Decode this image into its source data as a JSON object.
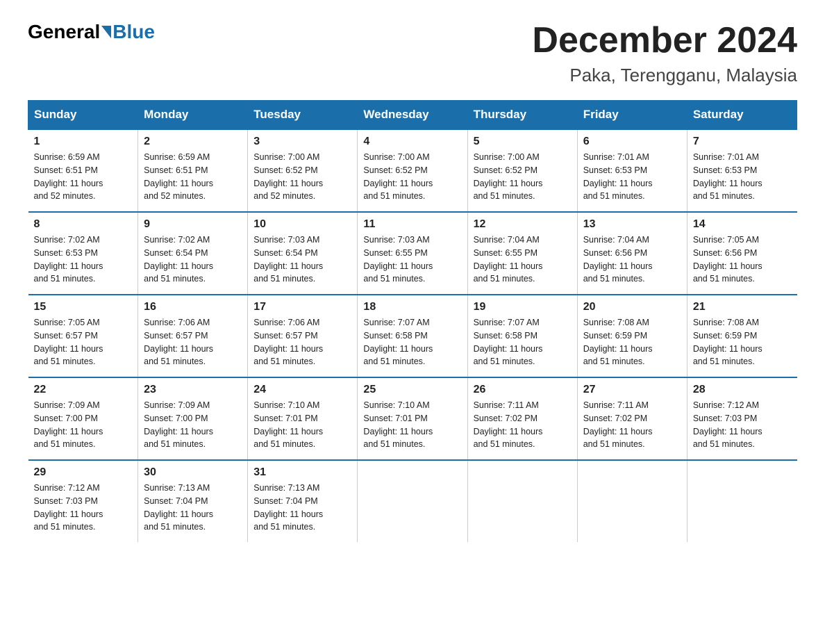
{
  "logo": {
    "general": "General",
    "blue": "Blue"
  },
  "title": "December 2024",
  "location": "Paka, Terengganu, Malaysia",
  "headers": [
    "Sunday",
    "Monday",
    "Tuesday",
    "Wednesday",
    "Thursday",
    "Friday",
    "Saturday"
  ],
  "weeks": [
    [
      {
        "day": "1",
        "sunrise": "6:59 AM",
        "sunset": "6:51 PM",
        "daylight": "11 hours and 52 minutes."
      },
      {
        "day": "2",
        "sunrise": "6:59 AM",
        "sunset": "6:51 PM",
        "daylight": "11 hours and 52 minutes."
      },
      {
        "day": "3",
        "sunrise": "7:00 AM",
        "sunset": "6:52 PM",
        "daylight": "11 hours and 52 minutes."
      },
      {
        "day": "4",
        "sunrise": "7:00 AM",
        "sunset": "6:52 PM",
        "daylight": "11 hours and 51 minutes."
      },
      {
        "day": "5",
        "sunrise": "7:00 AM",
        "sunset": "6:52 PM",
        "daylight": "11 hours and 51 minutes."
      },
      {
        "day": "6",
        "sunrise": "7:01 AM",
        "sunset": "6:53 PM",
        "daylight": "11 hours and 51 minutes."
      },
      {
        "day": "7",
        "sunrise": "7:01 AM",
        "sunset": "6:53 PM",
        "daylight": "11 hours and 51 minutes."
      }
    ],
    [
      {
        "day": "8",
        "sunrise": "7:02 AM",
        "sunset": "6:53 PM",
        "daylight": "11 hours and 51 minutes."
      },
      {
        "day": "9",
        "sunrise": "7:02 AM",
        "sunset": "6:54 PM",
        "daylight": "11 hours and 51 minutes."
      },
      {
        "day": "10",
        "sunrise": "7:03 AM",
        "sunset": "6:54 PM",
        "daylight": "11 hours and 51 minutes."
      },
      {
        "day": "11",
        "sunrise": "7:03 AM",
        "sunset": "6:55 PM",
        "daylight": "11 hours and 51 minutes."
      },
      {
        "day": "12",
        "sunrise": "7:04 AM",
        "sunset": "6:55 PM",
        "daylight": "11 hours and 51 minutes."
      },
      {
        "day": "13",
        "sunrise": "7:04 AM",
        "sunset": "6:56 PM",
        "daylight": "11 hours and 51 minutes."
      },
      {
        "day": "14",
        "sunrise": "7:05 AM",
        "sunset": "6:56 PM",
        "daylight": "11 hours and 51 minutes."
      }
    ],
    [
      {
        "day": "15",
        "sunrise": "7:05 AM",
        "sunset": "6:57 PM",
        "daylight": "11 hours and 51 minutes."
      },
      {
        "day": "16",
        "sunrise": "7:06 AM",
        "sunset": "6:57 PM",
        "daylight": "11 hours and 51 minutes."
      },
      {
        "day": "17",
        "sunrise": "7:06 AM",
        "sunset": "6:57 PM",
        "daylight": "11 hours and 51 minutes."
      },
      {
        "day": "18",
        "sunrise": "7:07 AM",
        "sunset": "6:58 PM",
        "daylight": "11 hours and 51 minutes."
      },
      {
        "day": "19",
        "sunrise": "7:07 AM",
        "sunset": "6:58 PM",
        "daylight": "11 hours and 51 minutes."
      },
      {
        "day": "20",
        "sunrise": "7:08 AM",
        "sunset": "6:59 PM",
        "daylight": "11 hours and 51 minutes."
      },
      {
        "day": "21",
        "sunrise": "7:08 AM",
        "sunset": "6:59 PM",
        "daylight": "11 hours and 51 minutes."
      }
    ],
    [
      {
        "day": "22",
        "sunrise": "7:09 AM",
        "sunset": "7:00 PM",
        "daylight": "11 hours and 51 minutes."
      },
      {
        "day": "23",
        "sunrise": "7:09 AM",
        "sunset": "7:00 PM",
        "daylight": "11 hours and 51 minutes."
      },
      {
        "day": "24",
        "sunrise": "7:10 AM",
        "sunset": "7:01 PM",
        "daylight": "11 hours and 51 minutes."
      },
      {
        "day": "25",
        "sunrise": "7:10 AM",
        "sunset": "7:01 PM",
        "daylight": "11 hours and 51 minutes."
      },
      {
        "day": "26",
        "sunrise": "7:11 AM",
        "sunset": "7:02 PM",
        "daylight": "11 hours and 51 minutes."
      },
      {
        "day": "27",
        "sunrise": "7:11 AM",
        "sunset": "7:02 PM",
        "daylight": "11 hours and 51 minutes."
      },
      {
        "day": "28",
        "sunrise": "7:12 AM",
        "sunset": "7:03 PM",
        "daylight": "11 hours and 51 minutes."
      }
    ],
    [
      {
        "day": "29",
        "sunrise": "7:12 AM",
        "sunset": "7:03 PM",
        "daylight": "11 hours and 51 minutes."
      },
      {
        "day": "30",
        "sunrise": "7:13 AM",
        "sunset": "7:04 PM",
        "daylight": "11 hours and 51 minutes."
      },
      {
        "day": "31",
        "sunrise": "7:13 AM",
        "sunset": "7:04 PM",
        "daylight": "11 hours and 51 minutes."
      },
      null,
      null,
      null,
      null
    ]
  ],
  "labels": {
    "sunrise": "Sunrise:",
    "sunset": "Sunset:",
    "daylight": "Daylight:"
  }
}
